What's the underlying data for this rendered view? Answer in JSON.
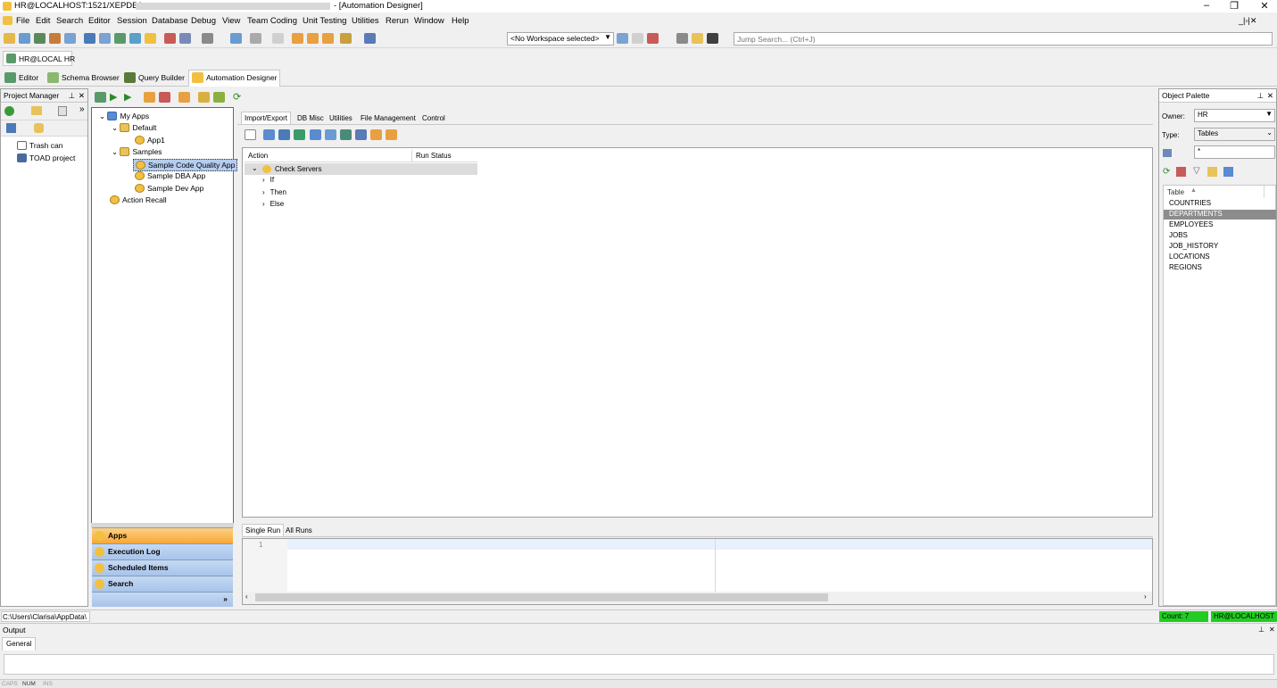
{
  "window": {
    "title_prefix": "HR@LOCALHOST:1521/XEPDB1 -",
    "title_suffix": "- [Automation Designer]",
    "min": "–",
    "max": "❐",
    "close": "✕"
  },
  "menu": [
    "File",
    "Edit",
    "Search",
    "Editor",
    "Session",
    "Database",
    "Debug",
    "View",
    "Team Coding",
    "Unit Testing",
    "Utilities",
    "Rerun",
    "Window",
    "Help"
  ],
  "toolbar": {
    "workspace": "<No Workspace selected>",
    "jump_search_placeholder": "Jump Search... (Ctrl+J)"
  },
  "connection": {
    "label": "HR@LOCAL HR"
  },
  "window_tabs": [
    "Editor",
    "Schema Browser",
    "Query Builder",
    "Automation Designer"
  ],
  "project_manager": {
    "title": "Project Manager",
    "items": [
      "Trash can",
      "TOAD project"
    ]
  },
  "apps_tree": {
    "items": [
      "My Apps",
      "Default",
      "App1",
      "Samples",
      "Sample Code Quality App",
      "Sample DBA App",
      "Sample Dev App",
      "Action Recall"
    ]
  },
  "nav_buttons": [
    "Apps",
    "Execution Log",
    "Scheduled Items",
    "Search"
  ],
  "nav_more": "»",
  "designer_tabs": [
    "Import/Export",
    "DB Misc",
    "Utilities",
    "File Management",
    "Control"
  ],
  "action_table": {
    "columns": [
      "Action",
      "Run Status"
    ],
    "rows": [
      "Check Servers",
      "If",
      "Then",
      "Else"
    ]
  },
  "run_tabs": [
    "Single Run",
    "All Runs"
  ],
  "run_panel": {
    "line_number": "1"
  },
  "object_palette": {
    "title": "Object Palette",
    "owner_label": "Owner:",
    "owner_value": "HR",
    "type_label": "Type:",
    "type_value": "Tables",
    "filter_value": "*",
    "table_header": "Table",
    "tables": [
      "COUNTRIES",
      "DEPARTMENTS",
      "EMPLOYEES",
      "JOBS",
      "JOB_HISTORY",
      "LOCATIONS",
      "REGIONS"
    ],
    "selected_index": 1
  },
  "statusbar": {
    "path": "C:\\Users\\Clarisa\\AppData\\",
    "count": "Count: 7",
    "conn": "HR@LOCALHOST"
  },
  "output": {
    "title": "Output",
    "tab": "General"
  },
  "keys": [
    "CAPS",
    "NUM",
    "INS"
  ],
  "colors": {
    "accent_green": "#22cc22",
    "selection_gray": "#8c8c8c",
    "nav_active": "#f6a83a",
    "nav_blue": "#b5cdef"
  }
}
